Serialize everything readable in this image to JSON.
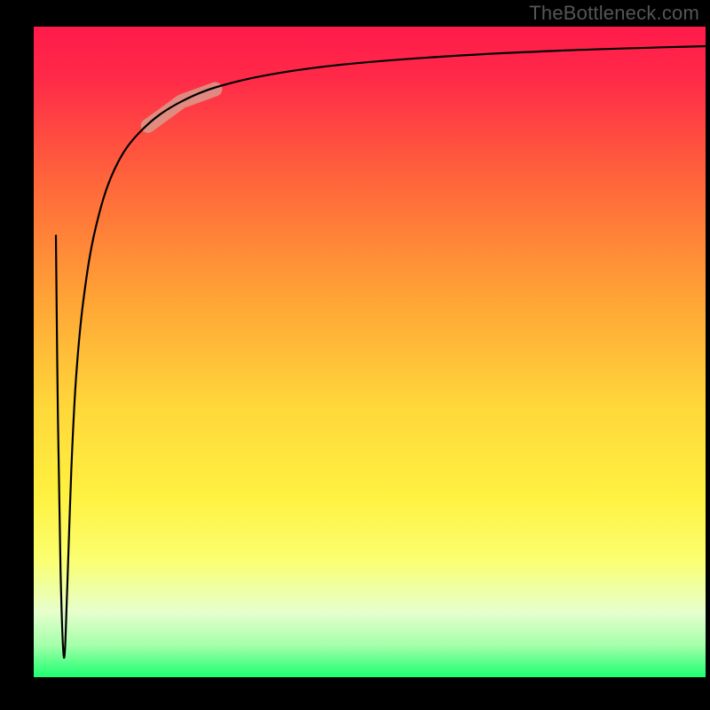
{
  "watermark": "TheBottleneck.com",
  "chart_data": {
    "type": "line",
    "title": "",
    "xlabel": "",
    "ylabel": "",
    "xlim": [
      0,
      100
    ],
    "ylim": [
      0,
      100
    ],
    "grid": false,
    "legend": false,
    "background_gradient": {
      "stops": [
        {
          "pct": 0,
          "color": "#ff1a4a"
        },
        {
          "pct": 8,
          "color": "#ff2a48"
        },
        {
          "pct": 25,
          "color": "#ff6a3a"
        },
        {
          "pct": 42,
          "color": "#ffa436"
        },
        {
          "pct": 58,
          "color": "#ffd63a"
        },
        {
          "pct": 72,
          "color": "#fff140"
        },
        {
          "pct": 82,
          "color": "#fbff70"
        },
        {
          "pct": 90,
          "color": "#e6ffcd"
        },
        {
          "pct": 95,
          "color": "#a6ffab"
        },
        {
          "pct": 100,
          "color": "#1cff70"
        }
      ]
    },
    "series": [
      {
        "name": "curve",
        "color": "#000000",
        "stroke_width": 2.2,
        "points": [
          {
            "x": 3.3,
            "y": 68
          },
          {
            "x": 3.6,
            "y": 40
          },
          {
            "x": 4.0,
            "y": 16
          },
          {
            "x": 4.5,
            "y": 3
          },
          {
            "x": 5.0,
            "y": 14
          },
          {
            "x": 5.6,
            "y": 32
          },
          {
            "x": 6.3,
            "y": 46
          },
          {
            "x": 7.4,
            "y": 58
          },
          {
            "x": 9.2,
            "y": 69
          },
          {
            "x": 12,
            "y": 78
          },
          {
            "x": 16,
            "y": 84
          },
          {
            "x": 22,
            "y": 88.5
          },
          {
            "x": 30,
            "y": 91.5
          },
          {
            "x": 42,
            "y": 93.7
          },
          {
            "x": 58,
            "y": 95.2
          },
          {
            "x": 78,
            "y": 96.3
          },
          {
            "x": 100,
            "y": 97.0
          }
        ]
      }
    ],
    "highlight_segment": {
      "on_series": "curve",
      "x_range": [
        17,
        27
      ],
      "color": "#d7a191",
      "opacity": 0.78,
      "stroke_width": 16
    }
  }
}
